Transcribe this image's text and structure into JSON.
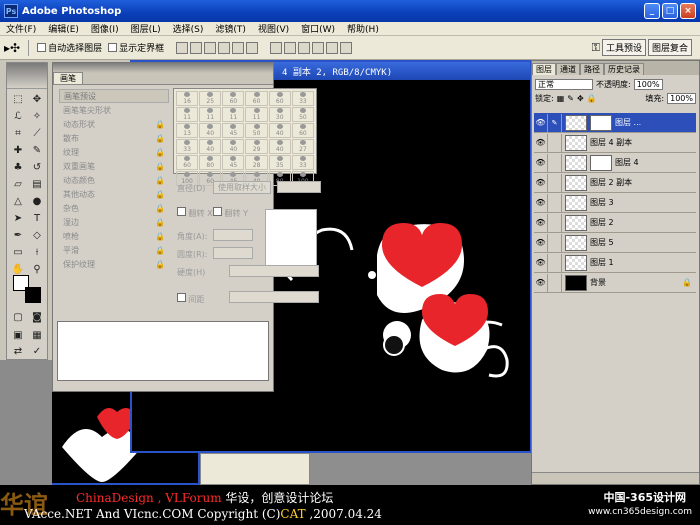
{
  "app": {
    "title": "Adobe Photoshop",
    "logo_text": "Ps"
  },
  "window_buttons": {
    "minimize": "_",
    "maximize": "□",
    "close": "×"
  },
  "menu": [
    "文件(F)",
    "编辑(E)",
    "图像(I)",
    "图层(L)",
    "选择(S)",
    "滤镜(T)",
    "视图(V)",
    "窗口(W)",
    "帮助(H)"
  ],
  "options": {
    "auto_select": "自动选择图层",
    "show_bounds": "显示定界框",
    "tool_presets": "工具预设",
    "layer_comps": "图层复合"
  },
  "doc": {
    "title": "4 副本 2, RGB/8/CMYK)"
  },
  "brush_panel": {
    "tab": "画笔",
    "presets_header": "画笔预设",
    "items": [
      "画笔笔尖形状",
      "动态形状",
      "散布",
      "纹理",
      "双重画笔",
      "动态颜色",
      "其他动态",
      "杂色",
      "湿边",
      "喷枪",
      "平滑",
      "保护纹理"
    ],
    "tip_sizes": [
      "16",
      "25",
      "60",
      "60",
      "60",
      "33",
      "11",
      "11",
      "11",
      "11",
      "30",
      "50",
      "13",
      "40",
      "45",
      "50",
      "40",
      "60",
      "33",
      "40",
      "40",
      "29",
      "40",
      "27",
      "60",
      "80",
      "45",
      "28",
      "35",
      "33",
      "100",
      "60",
      "45",
      "40",
      "80",
      "100"
    ],
    "diameter_label": "直径(D)",
    "use_sample": "使用取样大小",
    "flip_x": "翻转 X",
    "flip_y": "翻转 Y",
    "angle_label": "角度(A):",
    "roundness_label": "圆度(R):",
    "hardness_label": "硬度(H)",
    "spacing_label": "间距"
  },
  "layers_panel": {
    "tabs": [
      "图层",
      "通道",
      "路径",
      "历史记录"
    ],
    "blend_mode": "正常",
    "opacity_label": "不透明度:",
    "opacity_value": "100%",
    "lock_label": "锁定:",
    "fill_label": "填充:",
    "fill_value": "100%",
    "layers": [
      {
        "name": "图层 ...",
        "active": true,
        "mask": true
      },
      {
        "name": "图层 4 副本",
        "active": false,
        "mask": false
      },
      {
        "name": "图层 4",
        "active": false,
        "mask": true
      },
      {
        "name": "图层 2 副本",
        "active": false,
        "mask": false
      },
      {
        "name": "图层 3",
        "active": false,
        "mask": false
      },
      {
        "name": "图层 2",
        "active": false,
        "mask": false
      },
      {
        "name": "图层 5",
        "active": false,
        "mask": false
      },
      {
        "name": "图层 1",
        "active": false,
        "mask": false
      },
      {
        "name": "背景",
        "active": false,
        "mask": false,
        "black": true
      }
    ]
  },
  "credits": {
    "brand": "华谊",
    "line1_a": "ChinaDesign , ",
    "line1_b": "VLForum",
    "line1_c": "  华设，创意设计论坛",
    "line2_a": "VAcce.NET   And   VIcnc.COM   Copyright (C)",
    "line2_b": "CAT",
    "line2_c": " ,2007.04.24",
    "site_cn": "中国-365设计网",
    "site_url": "www.cn365design.com"
  }
}
